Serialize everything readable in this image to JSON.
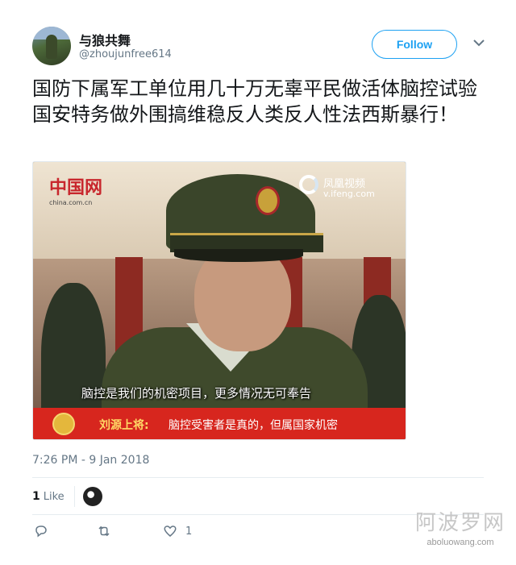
{
  "user": {
    "display_name": "与狼共舞",
    "handle": "@zhoujunfree614"
  },
  "follow_label": "Follow",
  "tweet": {
    "text": "国防下属军工单位用几十万无辜平民做活体脑控试验国安特务做外围搞维稳反人类反人性法西斯暴行！",
    "timestamp": "7:26 PM - 9 Jan 2018"
  },
  "media": {
    "logo_left": "中国网",
    "logo_left_url": "china.com.cn",
    "logo_right": "凤凰视频",
    "logo_right_url": "v.ifeng.com",
    "subtitle": "脑控是我们的机密项目，更多情况无可奉告",
    "lower_third_speaker": "刘源上将:",
    "lower_third_text": "脑控受害者是真的，但属国家机密"
  },
  "likes": {
    "count": "1",
    "label": "Like"
  },
  "actions": {
    "reply_icon": "reply-icon",
    "retweet_icon": "retweet-icon",
    "like_icon": "heart-icon",
    "like_count": "1"
  },
  "watermark": {
    "title": "阿波罗网",
    "url": "aboluowang.com"
  },
  "colors": {
    "accent": "#1da1f2",
    "text": "#14171a",
    "muted": "#657786",
    "broadcast_red": "#d7261e"
  }
}
